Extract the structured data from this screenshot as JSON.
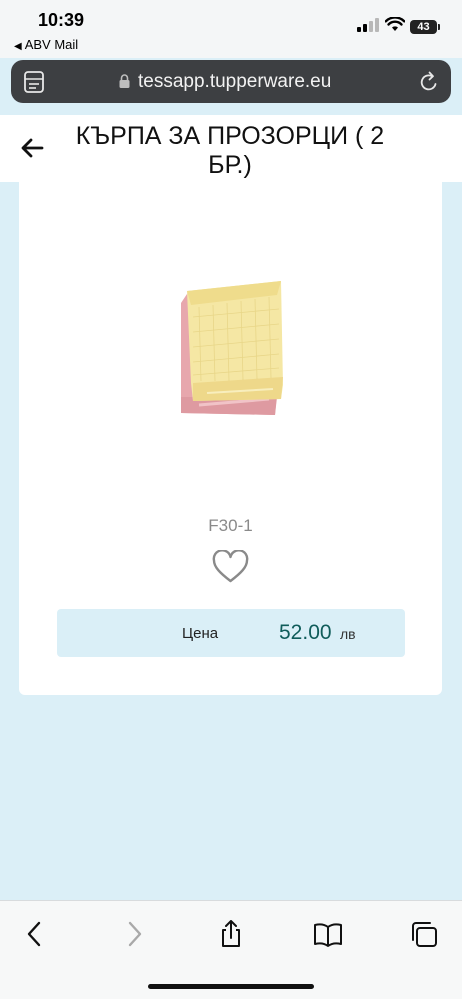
{
  "status_bar": {
    "time": "10:39",
    "back_app": "ABV Mail",
    "battery": "43"
  },
  "browser": {
    "url": "tessapp.tupperware.eu"
  },
  "header": {
    "title": "КЪРПА ЗА ПРОЗОРЦИ ( 2 БР.)"
  },
  "product": {
    "sku": "F30-1",
    "price_label": "Цена",
    "price_value": "52.00",
    "currency": "лв"
  },
  "colors": {
    "page_background": "#dbeff7",
    "price_box": "#daeff7",
    "price_text": "#0f5c5a",
    "address_bar": "#3d3f42"
  },
  "icons": {
    "back": "arrow-left-icon",
    "favorite": "heart-outline-icon",
    "toolbar": [
      "chevron-left-icon",
      "chevron-right-icon",
      "share-icon",
      "book-icon",
      "tabs-icon"
    ]
  }
}
